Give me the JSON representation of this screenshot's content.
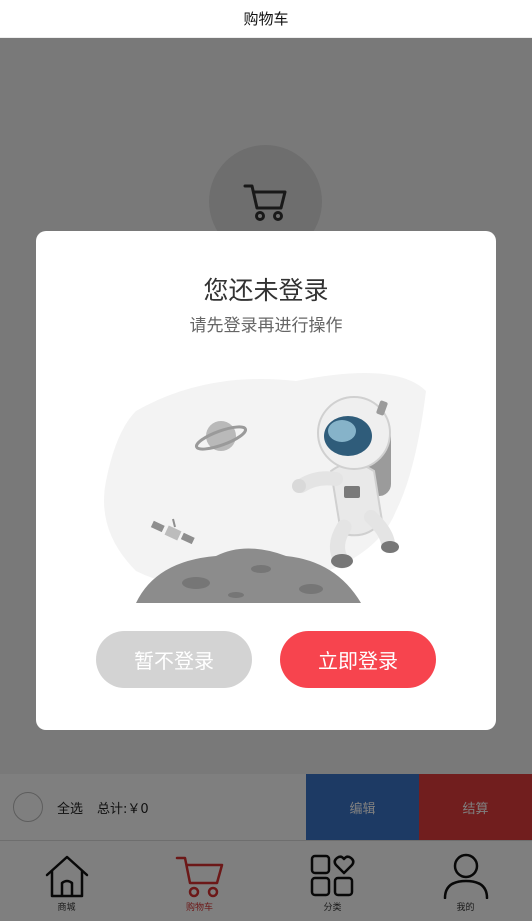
{
  "header": {
    "title": "购物车"
  },
  "action_bar": {
    "select_all_label": "全选",
    "total_label": "总计:￥0",
    "edit_label": "编辑",
    "checkout_label": "结算"
  },
  "tabbar": {
    "items": [
      {
        "label": "商城",
        "icon": "home-icon",
        "active": false
      },
      {
        "label": "购物车",
        "icon": "cart-icon",
        "active": true
      },
      {
        "label": "分类",
        "icon": "category-icon",
        "active": false
      },
      {
        "label": "我的",
        "icon": "user-icon",
        "active": false
      }
    ]
  },
  "modal": {
    "title": "您还未登录",
    "subtitle": "请先登录再进行操作",
    "illustration": "astronaut-illustration",
    "later_button": "暂不登录",
    "login_button": "立即登录"
  },
  "colors": {
    "login_button": "#f7444e",
    "later_button": "#d3d3d3",
    "edit_button": "#3a74c9",
    "checkout_button": "#e33c3c",
    "active_tab": "#d93030"
  }
}
